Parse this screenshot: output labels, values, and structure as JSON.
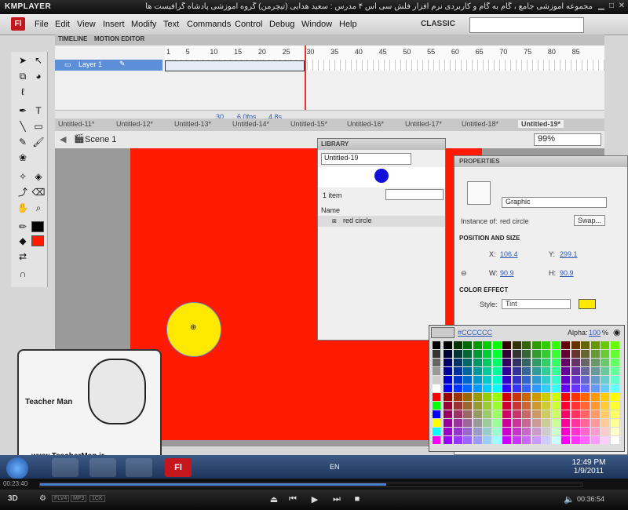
{
  "player": {
    "name": "KMPLAYER",
    "title": "مجموعه آموزشی جامع ، گام به گام و کاربردی نرم افزار فلش سی اس ۴ مدرس : سعید هدایی (تیچرمن) گروه آموزشی پادشاه گرافیست ها",
    "time_elapsed": "00:23:40",
    "time_total": "00:36:54",
    "badges": [
      "FLV4",
      "MP3",
      "1CK"
    ],
    "progress_fraction": 0.64
  },
  "app": {
    "logo": "Fl",
    "menus": [
      "File",
      "Edit",
      "View",
      "Insert",
      "Modify",
      "Text",
      "Commands",
      "Control",
      "Debug",
      "Window",
      "Help"
    ],
    "workspace": "CLASSIC",
    "search_placeholder": ""
  },
  "timeline": {
    "tabs": [
      "TIMELINE",
      "MOTION EDITOR"
    ],
    "ruler": [
      "1",
      "5",
      "10",
      "15",
      "20",
      "25",
      "30",
      "35",
      "40",
      "45",
      "50",
      "55",
      "60",
      "65",
      "70",
      "75",
      "80",
      "85"
    ],
    "layer_name": "Layer 1",
    "current_frame": "30",
    "fps": "6.0fps",
    "elapsed": "4.8s"
  },
  "documents": {
    "tabs": [
      "Untitled-11*",
      "Untitled-12*",
      "Untitled-13*",
      "Untitled-14*",
      "Untitled-15*",
      "Untitled-16*",
      "Untitled-17*",
      "Untitled-18*",
      "Untitled-19*"
    ],
    "active": "Untitled-19*",
    "scene": "Scene 1",
    "zoom": "99%"
  },
  "library": {
    "title": "LIBRARY",
    "document": "Untitled-19",
    "count": "1 item",
    "column": "Name",
    "items": [
      "red circle"
    ]
  },
  "properties": {
    "title": "PROPERTIES",
    "type": "Graphic",
    "instance_label": "Instance of:",
    "instance_of": "red circle",
    "swap": "Swap...",
    "section_pos": "POSITION AND SIZE",
    "x_label": "X:",
    "x": "106.4",
    "y_label": "Y:",
    "y": "299.1",
    "w_label": "W:",
    "w": "90.9",
    "h_label": "H:",
    "h": "90.9",
    "section_color": "COLOR EFFECT",
    "style_label": "Style:",
    "style": "Tint"
  },
  "swatches": {
    "hex": "#CCCCCC",
    "alpha_label": "Alpha:",
    "alpha": "100",
    "alpha_unit": "%"
  },
  "overlay": {
    "url": "www.TeacherMan.ir",
    "brand": "Teacher Man"
  },
  "taskbar": {
    "lang": "EN",
    "time": "12:49 PM",
    "date": "1/9/2011",
    "flash_label": "Fl"
  },
  "colors": {
    "stage": "#ff1a00",
    "circle": "#ffe900",
    "tint": "#ffe900",
    "selection": "#5d8fd8"
  }
}
